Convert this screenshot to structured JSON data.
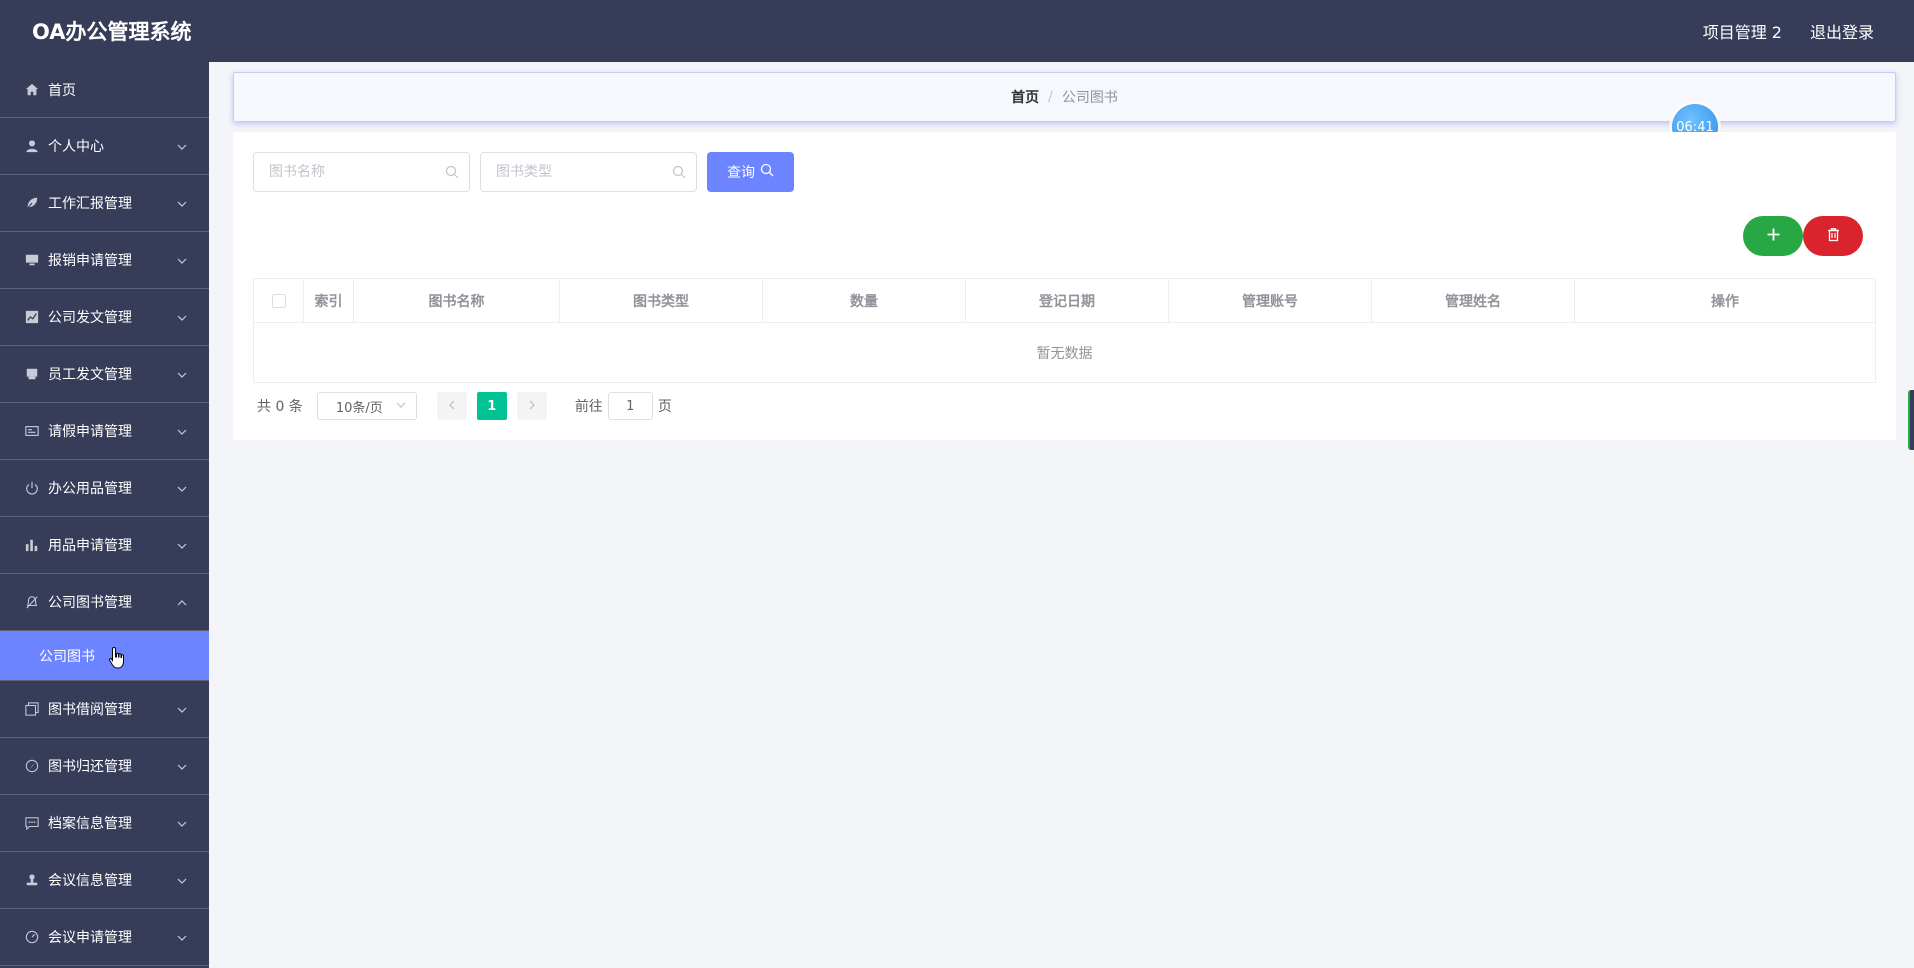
{
  "app": {
    "title": "OA办公管理系统",
    "user_label": "项目管理 2",
    "logout_label": "退出登录"
  },
  "sidebar": {
    "home": {
      "label": "首页",
      "icon": "home-icon"
    },
    "items": [
      {
        "label": "个人中心",
        "icon": "user-icon"
      },
      {
        "label": "工作汇报管理",
        "icon": "leaf-icon"
      },
      {
        "label": "报销申请管理",
        "icon": "monitor-icon"
      },
      {
        "label": "公司发文管理",
        "icon": "chart-icon"
      },
      {
        "label": "员工发文管理",
        "icon": "printer-icon"
      },
      {
        "label": "请假申请管理",
        "icon": "id-card-icon"
      },
      {
        "label": "办公用品管理",
        "icon": "power-icon"
      },
      {
        "label": "用品申请管理",
        "icon": "bar-chart-icon"
      },
      {
        "label": "公司图书管理",
        "icon": "bell-off-icon"
      }
    ],
    "sub_item": "公司图书",
    "items_after": [
      {
        "label": "图书借阅管理",
        "icon": "copy-icon"
      },
      {
        "label": "图书归还管理",
        "icon": "compass-icon"
      },
      {
        "label": "档案信息管理",
        "icon": "chat-icon"
      },
      {
        "label": "会议信息管理",
        "icon": "stamp-icon"
      },
      {
        "label": "会议申请管理",
        "icon": "gauge-icon"
      }
    ]
  },
  "breadcrumb": {
    "home": "首页",
    "separator": "/",
    "current": "公司图书"
  },
  "timer": "06:41",
  "search": {
    "name_placeholder": "图书名称",
    "type_placeholder": "图书类型",
    "query_label": "查询"
  },
  "table": {
    "columns": [
      "索引",
      "图书名称",
      "图书类型",
      "数量",
      "登记日期",
      "管理账号",
      "管理姓名",
      "操作"
    ],
    "empty_text": "暂无数据"
  },
  "pager": {
    "total": "共 0 条",
    "page_size": "10条/页",
    "current_page": "1",
    "goto_label": "前往",
    "goto_value": "1",
    "page_suffix": "页"
  },
  "colors": {
    "header_bg": "#373c59",
    "accent": "#6c84ff",
    "add": "#27a844",
    "delete": "#d9232d",
    "page_active": "#00c292"
  }
}
